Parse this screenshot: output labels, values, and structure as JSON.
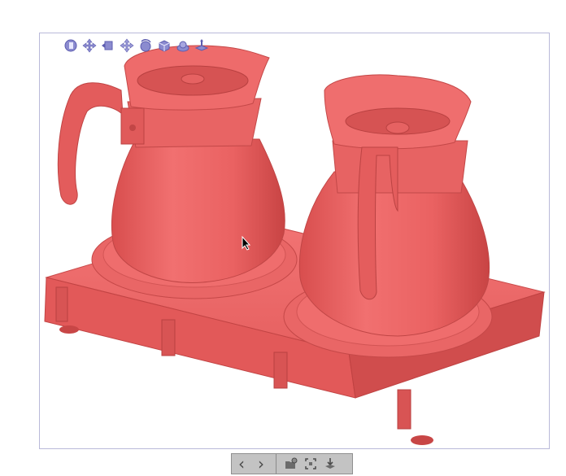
{
  "viewer": {
    "model_color": "#ec5f5f",
    "frame_color": "#b9b9d9",
    "toolbar_color": "#c3c3c3",
    "view_tools": [
      {
        "icon": "front-view-icon"
      },
      {
        "icon": "move-icon"
      },
      {
        "icon": "side-view-icon"
      },
      {
        "icon": "pan-icon"
      },
      {
        "icon": "rotate-icon"
      },
      {
        "icon": "box-view-icon"
      },
      {
        "icon": "orbit-icon"
      },
      {
        "icon": "top-view-icon"
      }
    ]
  },
  "toolbar": {
    "buttons": [
      {
        "icon": "previous-icon",
        "symbol": "‹"
      },
      {
        "icon": "next-icon",
        "symbol": "›"
      },
      {
        "icon": "open-model-icon"
      },
      {
        "icon": "fit-view-icon"
      },
      {
        "icon": "download-icon"
      }
    ]
  }
}
